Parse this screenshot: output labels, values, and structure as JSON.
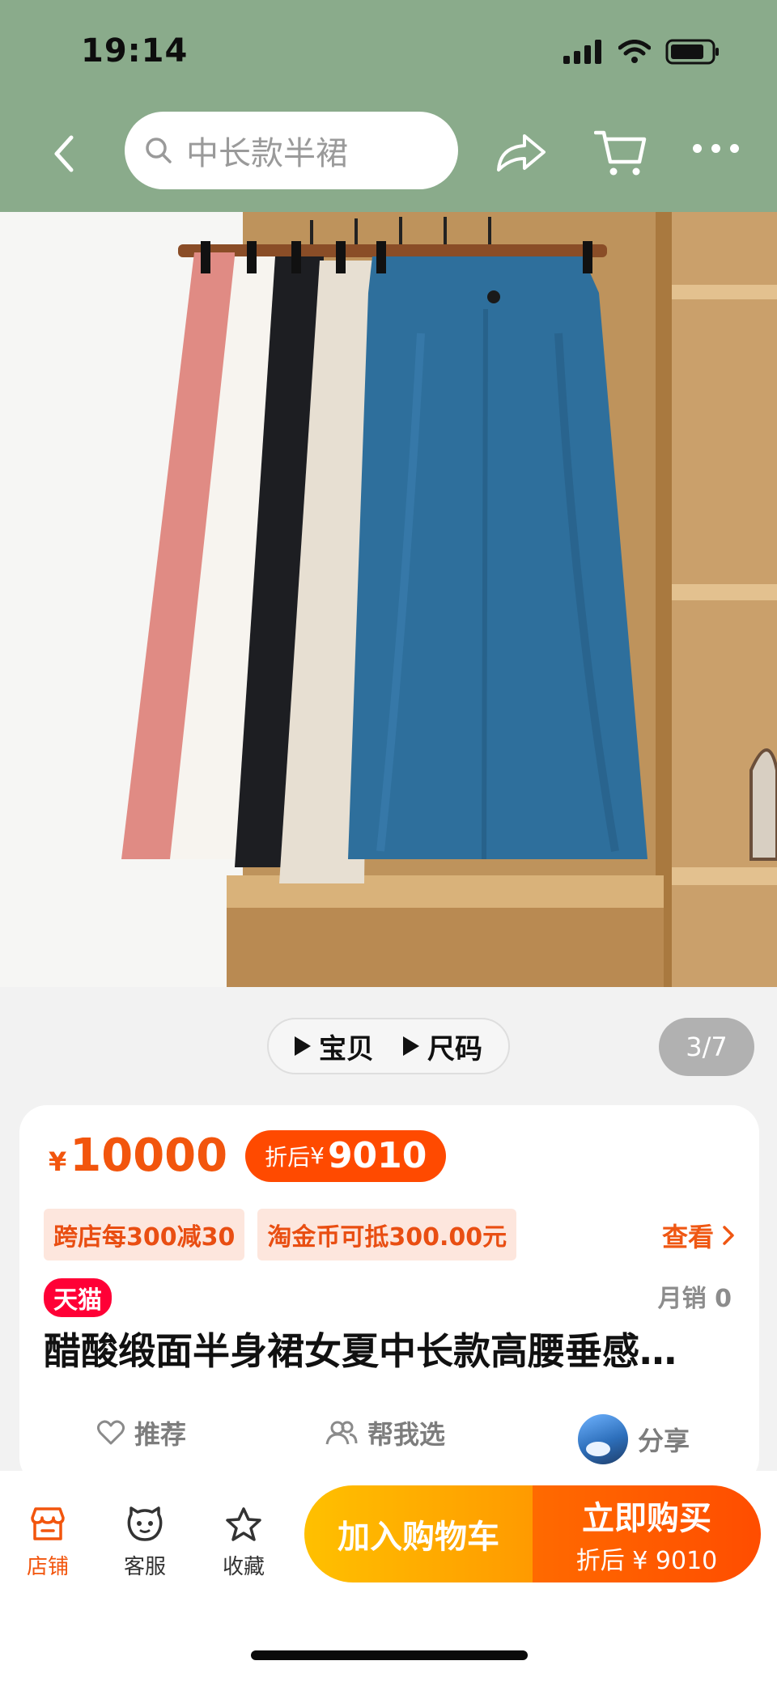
{
  "status_bar": {
    "time": "19:14"
  },
  "search": {
    "placeholder": "中长款半裙"
  },
  "gallery": {
    "media_tabs": [
      "宝贝",
      "尺码"
    ],
    "page_indicator": "3/7"
  },
  "colors": {
    "header_bg": "#8aab8b",
    "accent_orange": "#f2550d",
    "tmall_red": "#ff0036",
    "cart_btn": "#ffb000",
    "buy_btn": "#ff5500"
  },
  "product": {
    "price_symbol": "¥",
    "price": "10000",
    "discount_label": "折后",
    "discount_symbol": "¥",
    "discount_price": "9010",
    "promotions": [
      "跨店每300减30",
      "淘金币可抵300.00元"
    ],
    "promotions_more": "查看",
    "badge": "天猫",
    "monthly_sales": "月销 0",
    "title": "醋酸缎面半身裙女夏中长款高腰垂感…"
  },
  "actions": {
    "recommend": "推荐",
    "help_choose": "帮我选",
    "share": "分享"
  },
  "bottom_bar": {
    "store": "店铺",
    "service": "客服",
    "favorite": "收藏",
    "add_to_cart": "加入购物车",
    "buy_now": "立即购买",
    "buy_now_sub": "折后 ¥ 9010"
  }
}
